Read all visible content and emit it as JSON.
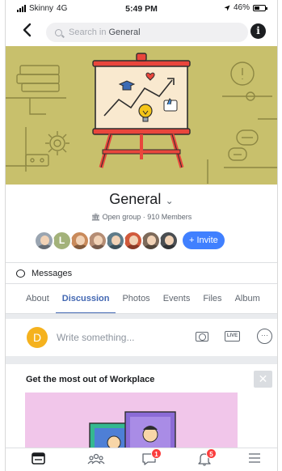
{
  "status_bar": {
    "carrier": "Skinny",
    "network": "4G",
    "time": "5:49 PM",
    "battery": "46%",
    "battery_level": 0.46
  },
  "header": {
    "search_placeholder": "Search in",
    "search_group": "General",
    "info_glyph": "i"
  },
  "group": {
    "name": "General",
    "type": "Open group",
    "member_count": "910 Members",
    "invite_label": "+ Invite",
    "member_avatars": [
      {
        "kind": "photo",
        "bg": "#9aa5b1"
      },
      {
        "kind": "letter",
        "letter": "L",
        "bg": "#a3b27a"
      },
      {
        "kind": "photo",
        "bg": "#c98a5b"
      },
      {
        "kind": "photo",
        "bg": "#b58d74"
      },
      {
        "kind": "photo",
        "bg": "#5f7c8a"
      },
      {
        "kind": "photo",
        "bg": "#d15a3c"
      },
      {
        "kind": "photo",
        "bg": "#7d6a5a"
      },
      {
        "kind": "photo",
        "bg": "#4a4e52"
      }
    ]
  },
  "messages_label": "Messages",
  "tabs": [
    {
      "label": "About",
      "active": false
    },
    {
      "label": "Discussion",
      "active": true
    },
    {
      "label": "Photos",
      "active": false
    },
    {
      "label": "Events",
      "active": false
    },
    {
      "label": "Files",
      "active": false
    },
    {
      "label": "Album",
      "active": false
    }
  ],
  "composer": {
    "avatar_letter": "D",
    "placeholder": "Write something...",
    "live_label": "LIVE",
    "more_glyph": "···"
  },
  "promo_card": {
    "title": "Get the most out of Workplace",
    "close_glyph": "✕"
  },
  "bottom_nav": {
    "chat_badge": "1",
    "notifications_badge": "5"
  },
  "colors": {
    "accent": "#4267b2",
    "invite": "#4080ff",
    "cover": "#c8c06c",
    "badge": "#fa3e3e"
  }
}
